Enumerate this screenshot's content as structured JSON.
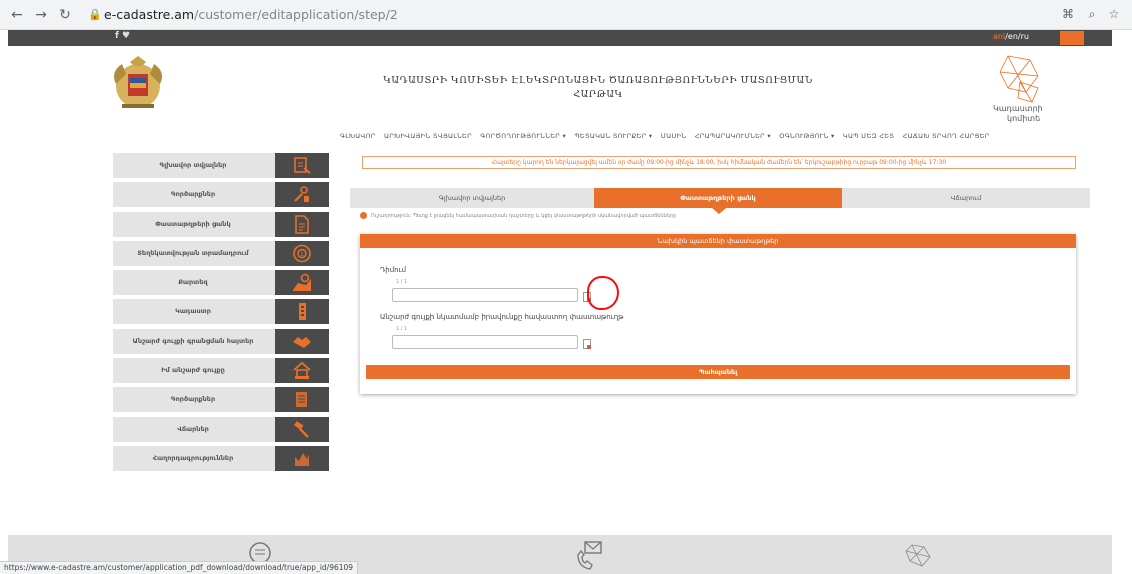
{
  "browser": {
    "lock_icon": "lock-icon",
    "url_host": "e-cadastre.am",
    "url_path": "/customer/editapplication/step/2"
  },
  "topbar": {
    "social": "f  ♥",
    "lang_active": "ani",
    "lang_other": "/en/ru"
  },
  "header": {
    "title_line1": "ԿԱԴԱՍՏՐԻ ԿՈՄԻՏԵԻ ԷԼԵԿՏՐՈՆԱՅԻՆ ԾԱՌԱՅՈՒԹՅՈՒՆՆԵՐԻ ՄԱՏՈՒՑՄԱՆ",
    "title_line2": "ՀԱՐԹԱԿ",
    "logo_text_1": "Կադաստրի",
    "logo_text_2": "կոմիտե"
  },
  "nav": [
    "ԳԼԽԱՎՈՐ",
    "ԱՐԽԻՎԱՅԻՆ ՏՎՅԱԼՆԵՐ",
    "ԳՈՐԾՈՂՈՒԹՅՈՒՆՆԵՐ ▾",
    "ՊԵՏԱԿԱՆ ՏՈՒՐՔԵՐ ▾",
    "ՄԱՍԻՆ",
    "ՀՐԱՊԱՐԱԿՈՒՄՆԵՐ ▾",
    "ՕԳՆՈՒԹՅՈՒՆ ▾",
    "ԿԱՊ ՄԵԶ ՀԵՏ",
    "ՀԱՃԱԽ ՏՐՎՈՂ ՀԱՐՑԵՐ"
  ],
  "sidebar": [
    {
      "label": "Գլխավոր տվյալներ",
      "icon": "document-icon"
    },
    {
      "label": "Գործարքներ",
      "icon": "tools-icon"
    },
    {
      "label": "Փաստաթղթերի ցանկ",
      "icon": "file-icon"
    },
    {
      "label": "Տեղեկատվության տրամադրում",
      "icon": "dial-icon"
    },
    {
      "label": "Քարտեզ",
      "icon": "map-icon"
    },
    {
      "label": "Կադաստր",
      "icon": "building-icon"
    },
    {
      "label": "Անշարժ գույքի գրանցման հայտեր",
      "icon": "handshake-icon"
    },
    {
      "label": "Իմ անշարժ գույքը",
      "icon": "house-icon"
    },
    {
      "label": "Գործարքներ",
      "icon": "folder-icon"
    },
    {
      "label": "Վճարներ",
      "icon": "hammer-icon"
    },
    {
      "label": "Հաղորդագրություններ",
      "icon": "graph-icon"
    }
  ],
  "content": {
    "notice": "Հայտերը կարող են ներկայացվել ամեն օր ժամը 09:00-ից մինչև 18:00, իսկ հիմնական ժամերն են՝ երկուշաբթիից ուրբաթ 09:00-ից մինչև 17:30",
    "tabs": [
      {
        "label": "Գլխավոր տվյալներ",
        "active": false
      },
      {
        "label": "Փաստաթղթերի ցանկ",
        "active": true
      },
      {
        "label": "Վճարում",
        "active": false
      }
    ],
    "info_text": "Ուշադրություն: Պետք է լրացնել համապատասխան դաշտերը և կցել փաստաթղթերի սկանավորված պատճենները",
    "form_title": "Նախկին պատճենի փաստաթղթեր",
    "field1_label": "Դիմում",
    "field1_sub": "1 / 1",
    "field1_value": "",
    "field2_label": "Անշարժ գույքի նկատմամբ իրավունքը հավաստող փաստաթուղթ",
    "field2_sub": "1 / 1",
    "field2_value": "",
    "submit_label": "Պահպանել"
  },
  "footer": {
    "status_url": "https://www.e-cadastre.am/customer/application_pdf_download/download/true/app_id/96109"
  },
  "colors": {
    "accent": "#e8702a",
    "dark": "#4a4a4a",
    "sidebar_bg": "#e4e4e4",
    "annotation": "#ff0a0a"
  }
}
